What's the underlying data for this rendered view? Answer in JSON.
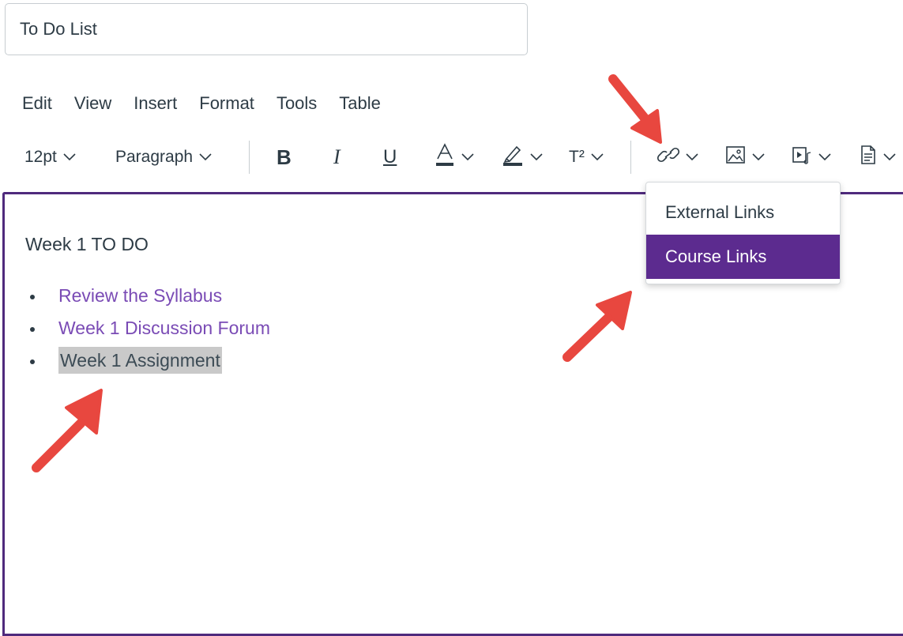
{
  "title_input": {
    "value": "To Do List"
  },
  "menubar": {
    "items": [
      "Edit",
      "View",
      "Insert",
      "Format",
      "Tools",
      "Table"
    ]
  },
  "toolbar": {
    "font_size": "12pt",
    "block_format": "Paragraph",
    "bold_glyph": "B",
    "italic_glyph": "I",
    "underline_glyph": "U",
    "superscript_glyph": "T²",
    "icons": [
      "bold-icon",
      "italic-icon",
      "underline-icon",
      "text-color-icon",
      "highlight-icon",
      "superscript-icon",
      "link-icon",
      "image-icon",
      "media-icon",
      "document-icon"
    ]
  },
  "editor": {
    "heading": "Week 1 TO DO",
    "items": [
      {
        "text": "Review the Syllabus",
        "type": "link"
      },
      {
        "text": "Week 1 Discussion Forum",
        "type": "link"
      },
      {
        "text": "Week 1 Assignment",
        "type": "selected"
      }
    ]
  },
  "link_dropdown": {
    "items": [
      {
        "label": "External Links",
        "active": false
      },
      {
        "label": "Course Links",
        "active": true
      }
    ]
  },
  "colors": {
    "accent": "#5c2b8f",
    "link": "#7a4bb5",
    "text": "#2d3b45",
    "annotation_arrow": "#e8473f",
    "selection": "#c9c9c9"
  }
}
